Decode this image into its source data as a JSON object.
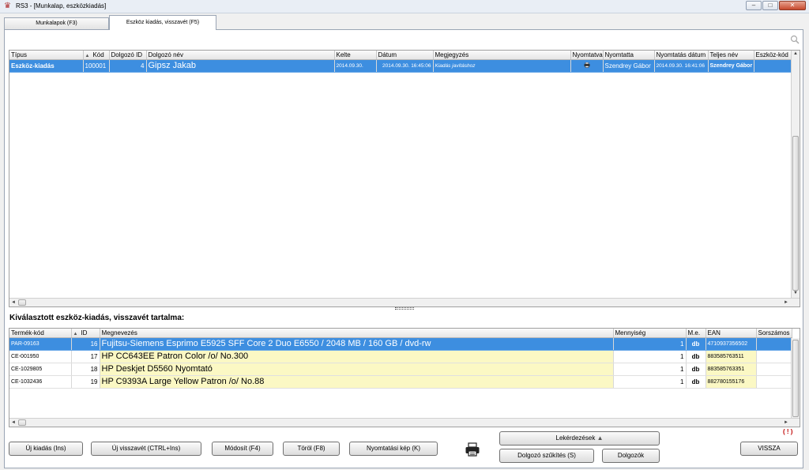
{
  "window": {
    "title": "RS3 - [Munkalap, eszközkiadás]"
  },
  "tabs": [
    {
      "label": "Munkalapok (F3)"
    },
    {
      "label": "Eszköz kiadás, visszavét (F5)"
    }
  ],
  "top_grid": {
    "columns": [
      "Típus",
      "Kód",
      "Dolgozó ID",
      "Dolgozó név",
      "Kelte",
      "Dátum",
      "Megjegyzés",
      "Nyomtatva",
      "Nyomtatta",
      "Nyomtatás dátum",
      "Teljes név",
      "Eszköz-kód"
    ],
    "rows": [
      {
        "tipus": "Eszköz-kiadás",
        "kod": "100001",
        "dolgozo_id": "4",
        "dolgozo_nev": "Gipsz Jakab",
        "kelte": "2014.09.30.",
        "datum": "2014.09.30. 16:45:06",
        "megjegyzes": "Kiadás javításhoz",
        "nyomtatta": "Szendrey Gábor",
        "nyomtatas_datum": "2014.09.30. 16:41:06",
        "teljes_nev": "Szendrey Gábor"
      }
    ]
  },
  "section_title": "Kiválasztott eszköz-kiadás, visszavét tartalma:",
  "bottom_grid": {
    "columns": [
      "Termék-kód",
      "ID",
      "Megnevezés",
      "Mennyiség",
      "M.e.",
      "EAN",
      "Sorszámos"
    ],
    "rows": [
      {
        "kod": "PAR-09163",
        "id": "16",
        "nev": "Fujitsu-Siemens Esprimo E5925 SFF Core 2 Duo E6550 / 2048 MB / 160 GB / dvd-rw",
        "menny": "1",
        "me": "db",
        "ean": "4710937356502"
      },
      {
        "kod": "CE-001950",
        "id": "17",
        "nev": "HP CC643EE Patron Color /o/ No.300",
        "menny": "1",
        "me": "db",
        "ean": "883585763511"
      },
      {
        "kod": "CE-1029805",
        "id": "18",
        "nev": "HP Deskjet D5560 Nyomtató",
        "menny": "1",
        "me": "db",
        "ean": "883585763351"
      },
      {
        "kod": "CE-1032436",
        "id": "19",
        "nev": "HP C9393A Large Yellow Patron /o/ No.88",
        "menny": "1",
        "me": "db",
        "ean": "882780155176"
      }
    ]
  },
  "warning": "( ! )",
  "buttons": {
    "uj_kiadas": "Új kiadás (Ins)",
    "uj_visszavet": "Új visszavét (CTRL+Ins)",
    "modosit": "Módosít (F4)",
    "torol": "Töröl (F8)",
    "nyomtatasi_kep": "Nyomtatási kép (K)",
    "lekerdezesek": "Lekérdezések",
    "dolgozo_szukites": "Dolgozó szűkítés (S)",
    "dolgozok": "Dolgozók",
    "vissza": "VISSZA"
  }
}
